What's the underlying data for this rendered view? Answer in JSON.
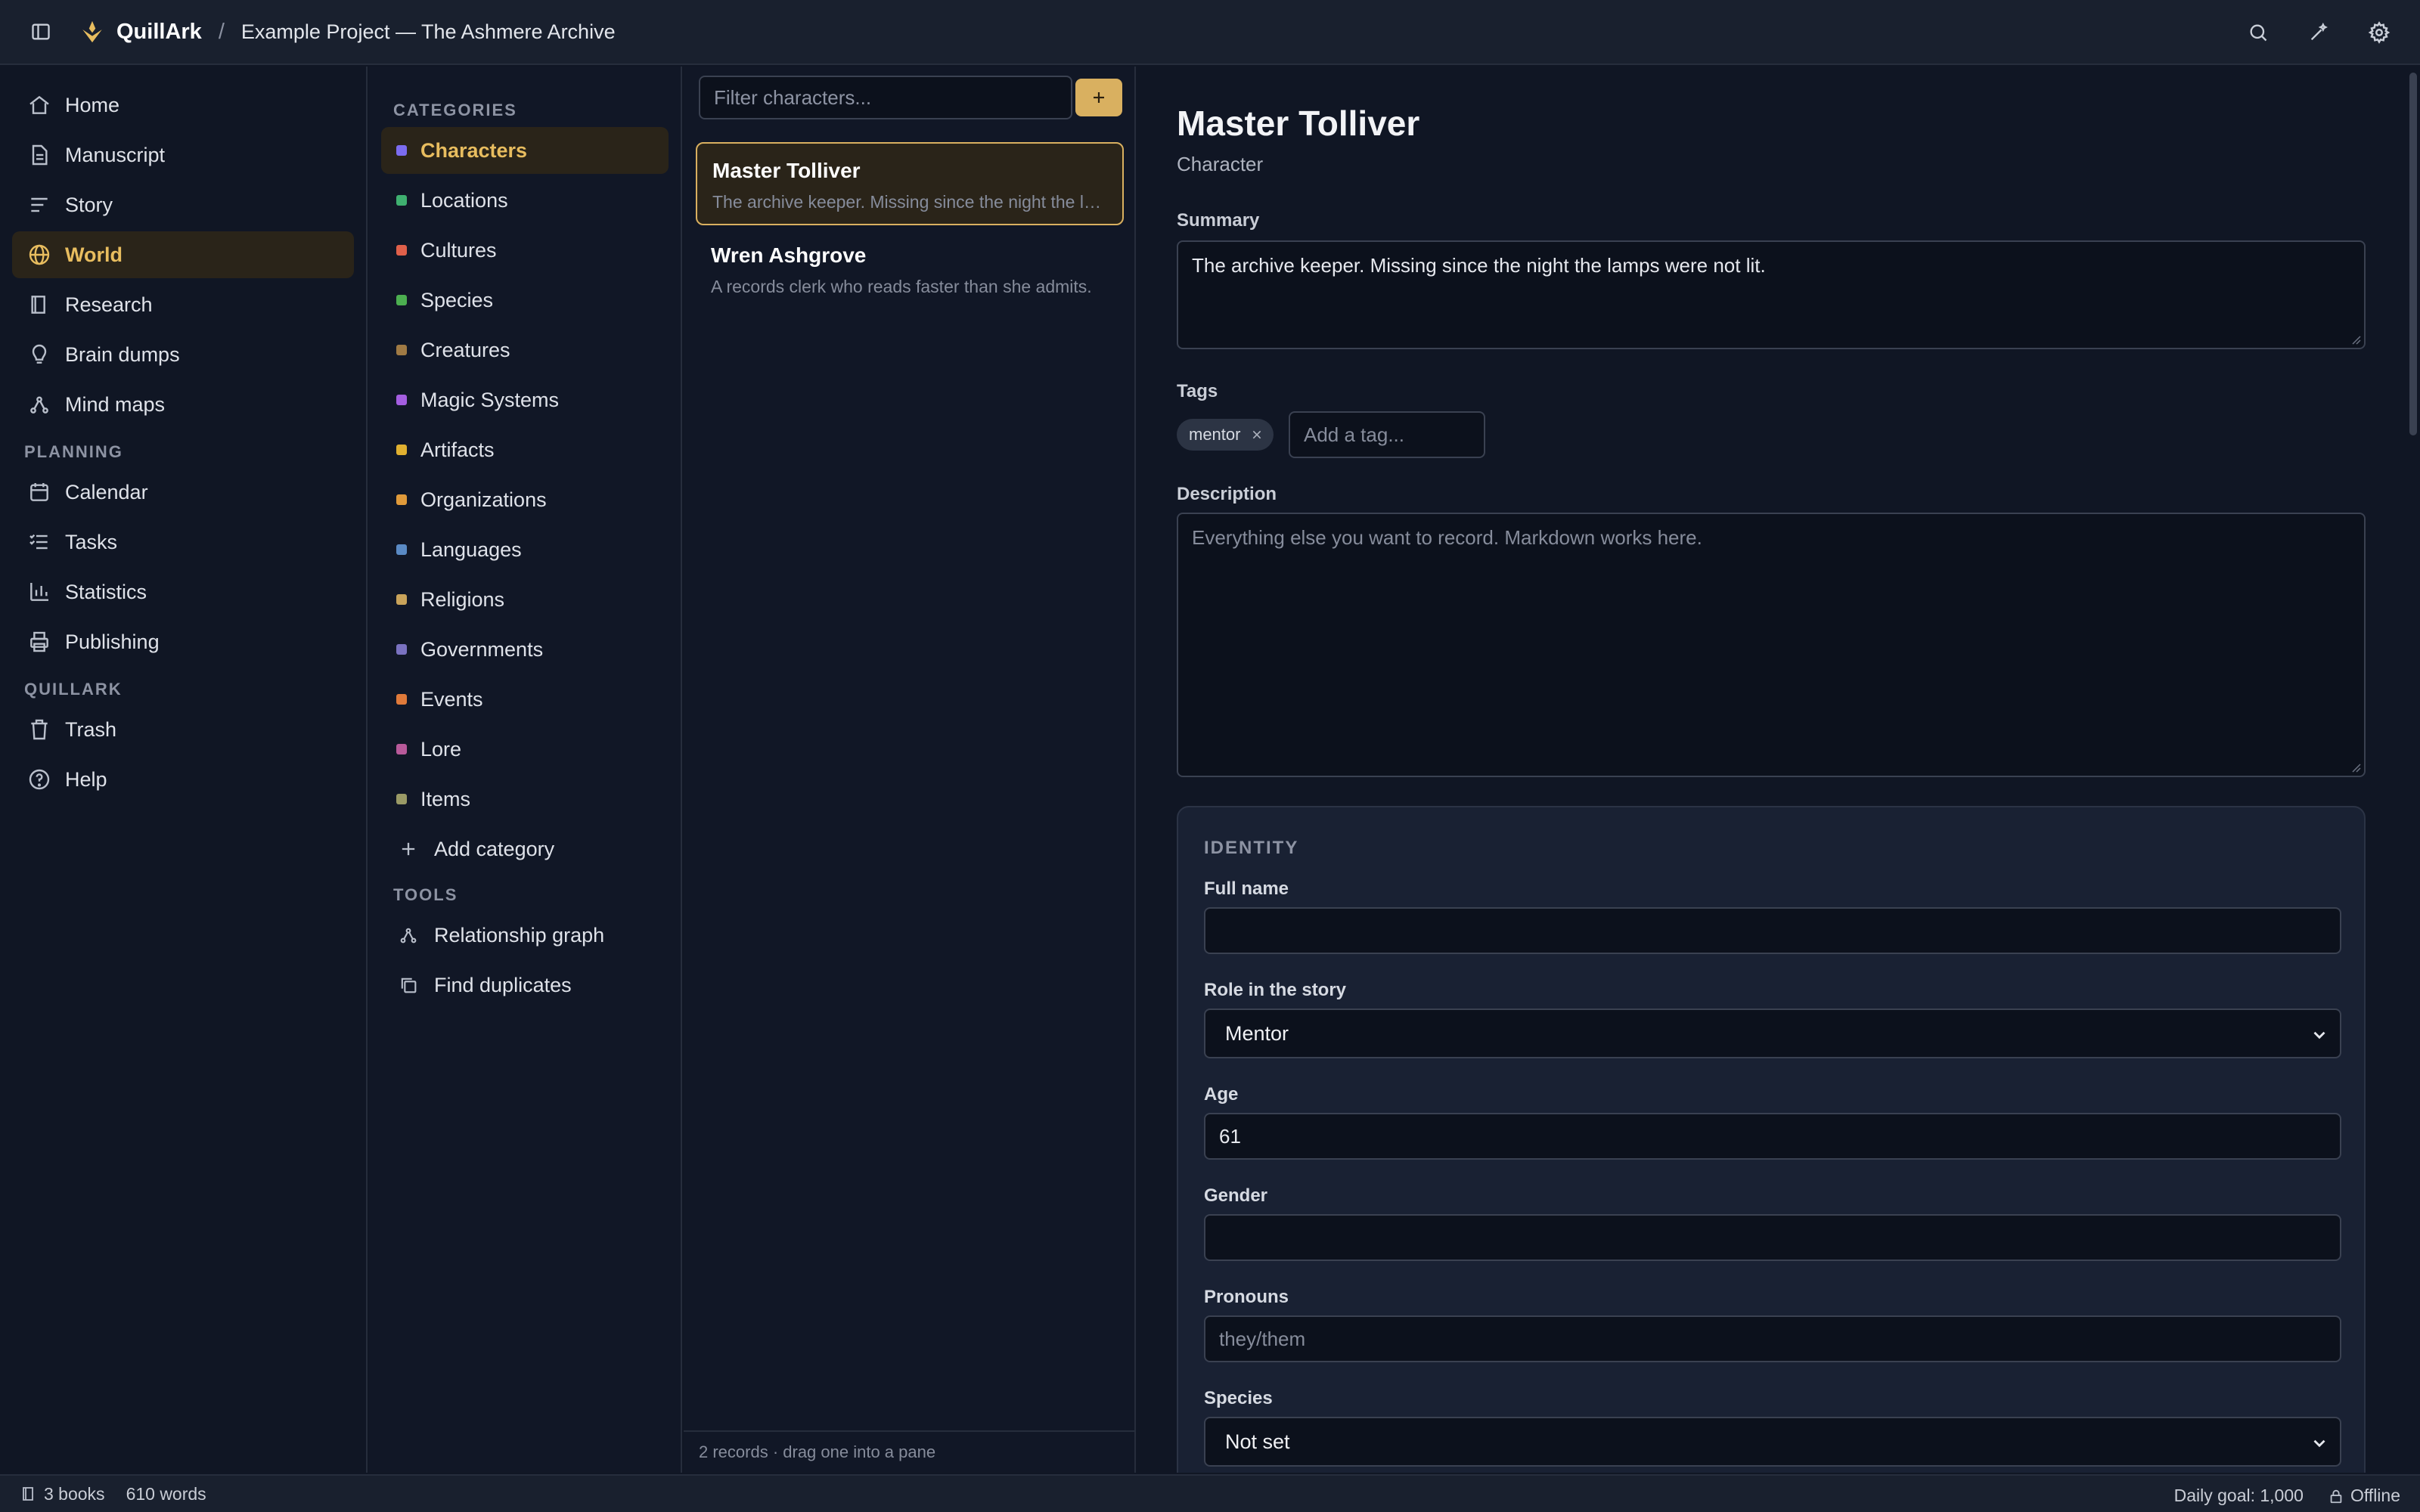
{
  "topbar": {
    "brand": "QuillArk",
    "separator": "/",
    "project": "Example Project — The Ashmere Archive",
    "icons": [
      "sidebar-toggle-icon",
      "quill-logo-icon",
      "search-icon",
      "wand-icon",
      "settings-gear-icon"
    ]
  },
  "nav": {
    "items": [
      {
        "label": "Home",
        "icon": "home-icon"
      },
      {
        "label": "Manuscript",
        "icon": "document-icon"
      },
      {
        "label": "Story",
        "icon": "list-icon"
      },
      {
        "label": "World",
        "icon": "globe-icon",
        "active": true
      },
      {
        "label": "Research",
        "icon": "book-icon"
      },
      {
        "label": "Brain dumps",
        "icon": "lightbulb-icon"
      },
      {
        "label": "Mind maps",
        "icon": "graph-icon"
      }
    ],
    "planning_label": "PLANNING",
    "planning": [
      {
        "label": "Calendar",
        "icon": "calendar-icon"
      },
      {
        "label": "Tasks",
        "icon": "tasks-icon"
      },
      {
        "label": "Statistics",
        "icon": "chart-icon"
      },
      {
        "label": "Publishing",
        "icon": "printer-icon"
      }
    ],
    "quillark_label": "QUILLARK",
    "quillark": [
      {
        "label": "Trash",
        "icon": "trash-icon"
      },
      {
        "label": "Help",
        "icon": "help-icon"
      }
    ]
  },
  "categories": {
    "label": "CATEGORIES",
    "items": [
      {
        "label": "Characters",
        "color": "#7b6cf0",
        "active": true
      },
      {
        "label": "Locations",
        "color": "#3fb070"
      },
      {
        "label": "Cultures",
        "color": "#e0604a"
      },
      {
        "label": "Species",
        "color": "#4caf50"
      },
      {
        "label": "Creatures",
        "color": "#a07a44"
      },
      {
        "label": "Magic Systems",
        "color": "#a45ee0"
      },
      {
        "label": "Artifacts",
        "color": "#e0b030"
      },
      {
        "label": "Organizations",
        "color": "#e09a3a"
      },
      {
        "label": "Languages",
        "color": "#5a8ac4"
      },
      {
        "label": "Religions",
        "color": "#c9a35a"
      },
      {
        "label": "Governments",
        "color": "#7a72c0"
      },
      {
        "label": "Events",
        "color": "#e07a3a"
      },
      {
        "label": "Lore",
        "color": "#b85a9a"
      },
      {
        "label": "Items",
        "color": "#9a9a66"
      }
    ],
    "add_label": "Add category",
    "tools_label": "TOOLS",
    "tools": [
      {
        "label": "Relationship graph",
        "icon": "graph-icon"
      },
      {
        "label": "Find duplicates",
        "icon": "copy-icon"
      }
    ]
  },
  "list": {
    "filter_placeholder": "Filter characters...",
    "add_button": "+",
    "records": [
      {
        "name": "Master Tolliver",
        "summary": "The archive keeper. Missing since the night the lamps were not lit.",
        "selected": true
      },
      {
        "name": "Wren Ashgrove",
        "summary": "A records clerk who reads faster than she admits."
      }
    ],
    "footer": "2 records · drag one into a pane"
  },
  "editor": {
    "title": "Master Tolliver",
    "type": "Character",
    "summary_label": "Summary",
    "summary_value": "The archive keeper. Missing since the night the lamps were not lit.",
    "tags_label": "Tags",
    "tags": [
      "mentor"
    ],
    "tag_placeholder": "Add a tag...",
    "description_label": "Description",
    "description_placeholder": "Everything else you want to record. Markdown works here.",
    "identity": {
      "title": "IDENTITY",
      "full_name_label": "Full name",
      "full_name_value": "",
      "role_label": "Role in the story",
      "role_value": "Mentor",
      "age_label": "Age",
      "age_value": "61",
      "gender_label": "Gender",
      "gender_value": "",
      "pronouns_label": "Pronouns",
      "pronouns_placeholder": "they/them",
      "species_label": "Species",
      "species_value": "Not set"
    }
  },
  "status": {
    "books": "3 books",
    "words": "610 words",
    "daily_goal": "Daily goal: 1,000",
    "connection": "Offline"
  }
}
